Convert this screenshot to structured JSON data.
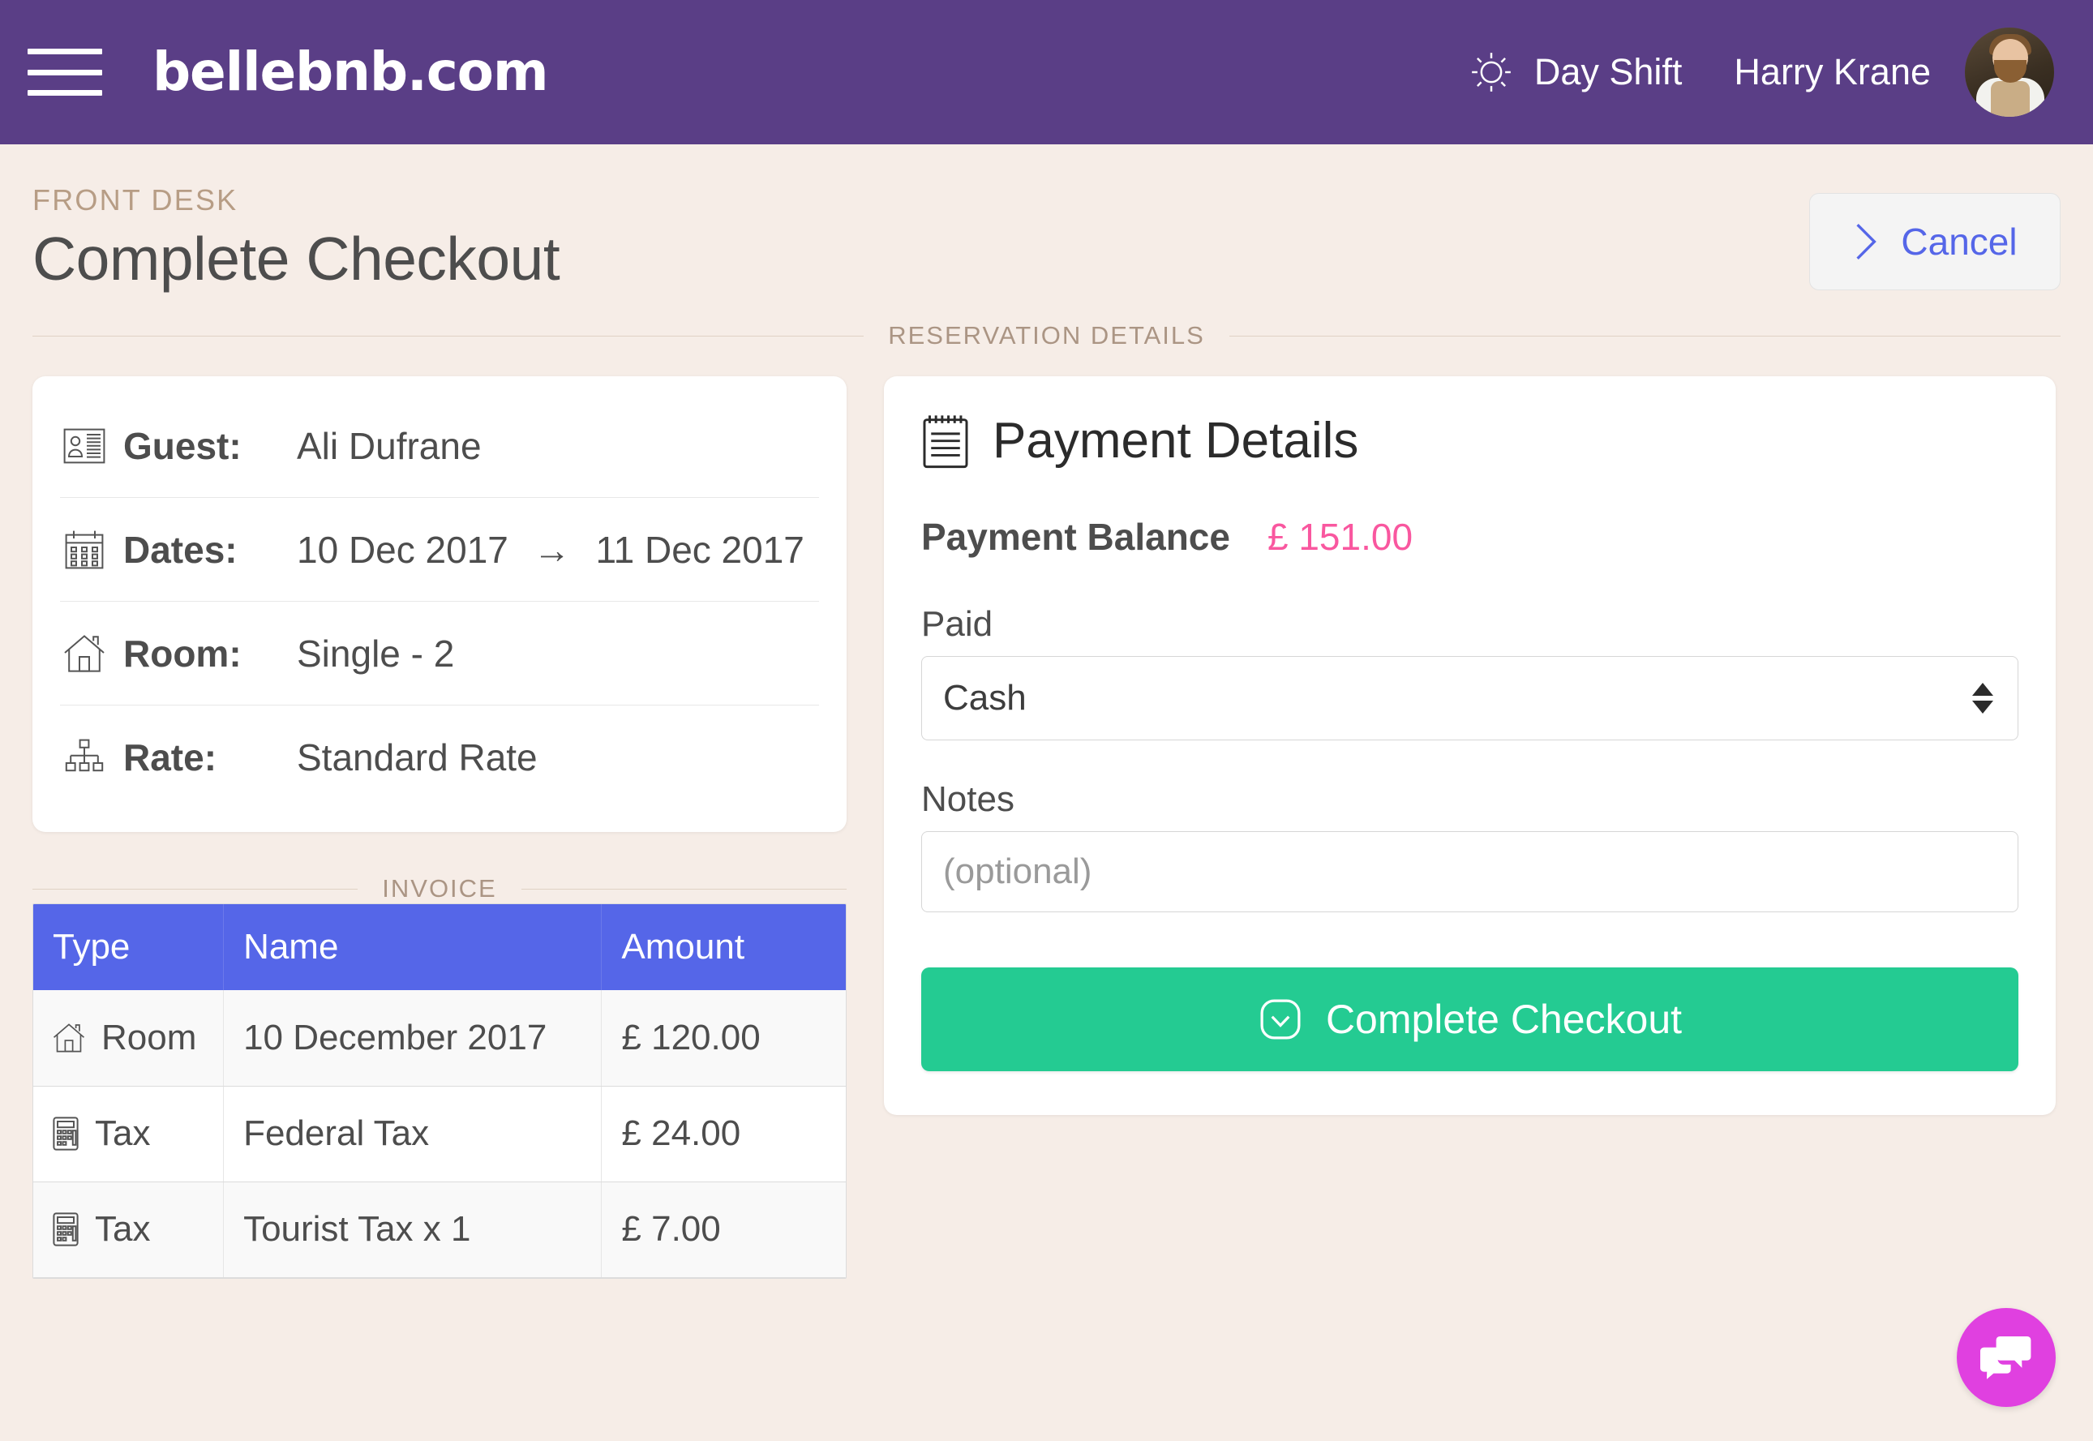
{
  "header": {
    "brand": "bellebnb.com",
    "shift_label": "Day Shift",
    "user_name": "Harry Krane",
    "menu_icon": "hamburger-menu-icon",
    "shift_icon": "sun-icon",
    "avatar_icon": "user-avatar"
  },
  "page": {
    "kicker": "FRONT DESK",
    "title": "Complete Checkout",
    "cancel_label": "Cancel"
  },
  "sections": {
    "reservation_details": "RESERVATION DETAILS",
    "invoice": "INVOICE"
  },
  "reservation": {
    "rows": [
      {
        "icon": "id-card-icon",
        "label": "Guest:",
        "value": "Ali Dufrane"
      },
      {
        "icon": "calendar-icon",
        "label": "Dates:",
        "value_start": "10 Dec 2017",
        "arrow": "→",
        "value_end": "11 Dec 2017"
      },
      {
        "icon": "house-icon",
        "label": "Room:",
        "value": "Single - 2"
      },
      {
        "icon": "sitemap-icon",
        "label": "Rate:",
        "value": "Standard Rate"
      }
    ]
  },
  "invoice": {
    "columns": [
      "Type",
      "Name",
      "Amount"
    ],
    "rows": [
      {
        "icon": "house-icon",
        "type": "Room",
        "name": "10 December 2017",
        "amount": "£ 120.00"
      },
      {
        "icon": "calculator-icon",
        "type": "Tax",
        "name": "Federal Tax",
        "amount": "£ 24.00"
      },
      {
        "icon": "calculator-icon",
        "type": "Tax",
        "name": "Tourist Tax x 1",
        "amount": "£ 7.00"
      }
    ]
  },
  "payment": {
    "title": "Payment Details",
    "title_icon": "notepad-icon",
    "balance_label": "Payment Balance",
    "balance_value": "£ 151.00",
    "paid_label": "Paid",
    "paid_value": "Cash",
    "notes_label": "Notes",
    "notes_placeholder": "(optional)",
    "notes_value": "",
    "submit_label": "Complete Checkout",
    "submit_icon": "check-square-icon"
  },
  "chat": {
    "icon": "chat-bubbles-icon"
  },
  "colors": {
    "nav_purple": "#5a3e86",
    "page_bg": "#f6ede7",
    "accent_blue": "#5566e8",
    "balance_pink": "#f9579f",
    "success_green": "#24cb92",
    "chat_magenta": "#e040e0",
    "divider_tan": "#ab9584"
  }
}
